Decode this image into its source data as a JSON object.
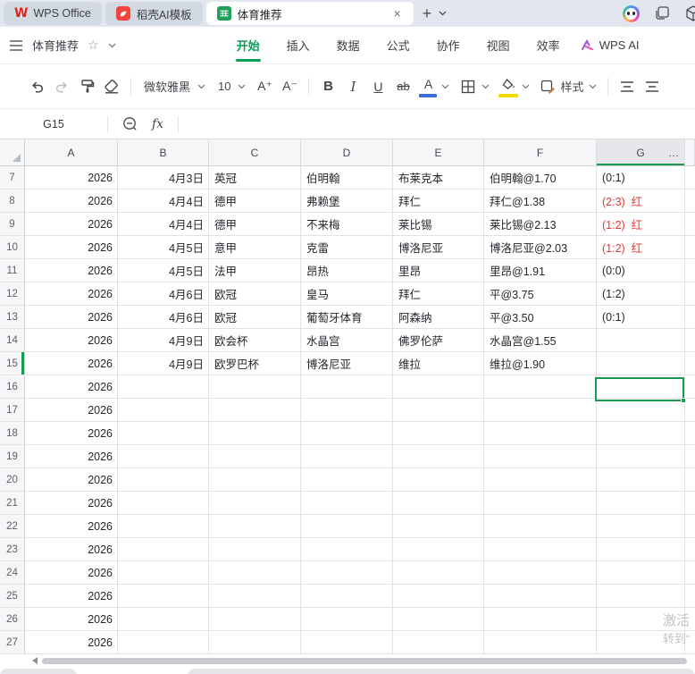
{
  "window": {
    "tabs": [
      {
        "label": "WPS Office"
      },
      {
        "label": "稻壳AI模板"
      },
      {
        "label": "体育推荐",
        "close_glyph": "×"
      }
    ],
    "new_tab_glyph": "+"
  },
  "menubar": {
    "doc_title": "体育推荐",
    "items": [
      "开始",
      "插入",
      "数据",
      "公式",
      "协作",
      "视图",
      "效率"
    ],
    "active_item": "开始",
    "wps_ai_label": "WPS AI"
  },
  "toolbar": {
    "font_name": "微软雅黑",
    "font_size": "10",
    "bold_label": "B",
    "italic_label": "I",
    "underline_label": "U",
    "strike_label": "ab",
    "font_color_label": "A",
    "increase_font_label": "A⁺",
    "decrease_font_label": "A⁻",
    "styles_label": "样式"
  },
  "formula_bar": {
    "cell_ref": "G15",
    "fx_label": "fx",
    "value": ""
  },
  "grid": {
    "columns": [
      "A",
      "B",
      "C",
      "D",
      "E",
      "F",
      "G"
    ],
    "selected_column": "G",
    "selected_cell": "G15",
    "selected_row": 15,
    "more_label": "…",
    "rows": [
      {
        "n": 7,
        "a": "2026",
        "b": "4月3日",
        "c": "英冠",
        "d": "伯明翰",
        "e": "布莱克本",
        "f": "伯明翰@1.70",
        "g": "(0:1)",
        "g_red": false
      },
      {
        "n": 8,
        "a": "2026",
        "b": "4月4日",
        "c": "德甲",
        "d": "弗赖堡",
        "e": "拜仁",
        "f": "拜仁@1.38",
        "g": "(2:3)  红",
        "g_red": true
      },
      {
        "n": 9,
        "a": "2026",
        "b": "4月4日",
        "c": "德甲",
        "d": "不来梅",
        "e": "莱比锡",
        "f": "莱比锡@2.13",
        "g": "(1:2)  红",
        "g_red": true
      },
      {
        "n": 10,
        "a": "2026",
        "b": "4月5日",
        "c": "意甲",
        "d": "克雷",
        "e": "博洛尼亚",
        "f": "博洛尼亚@2.03",
        "g": "(1:2)  红",
        "g_red": true
      },
      {
        "n": 11,
        "a": "2026",
        "b": "4月5日",
        "c": "法甲",
        "d": "昂热",
        "e": "里昂",
        "f": "里昂@1.91",
        "g": "(0:0)",
        "g_red": false
      },
      {
        "n": 12,
        "a": "2026",
        "b": "4月6日",
        "c": "欧冠",
        "d": "皇马",
        "e": "拜仁",
        "f": "平@3.75",
        "g": "(1:2)",
        "g_red": false
      },
      {
        "n": 13,
        "a": "2026",
        "b": "4月6日",
        "c": "欧冠",
        "d": "葡萄牙体育",
        "e": "阿森纳",
        "f": "平@3.50",
        "g": "(0:1)",
        "g_red": false
      },
      {
        "n": 14,
        "a": "2026",
        "b": "4月9日",
        "c": "欧会杯",
        "d": "水晶宫",
        "e": "佛罗伦萨",
        "f": "水晶宫@1.55",
        "g": "",
        "g_red": false
      },
      {
        "n": 15,
        "a": "2026",
        "b": "4月9日",
        "c": "欧罗巴杯",
        "d": "博洛尼亚",
        "e": "维拉",
        "f": "维拉@1.90",
        "g": "",
        "g_red": false
      },
      {
        "n": 16,
        "a": "2026"
      },
      {
        "n": 17,
        "a": "2026"
      },
      {
        "n": 18,
        "a": "2026"
      },
      {
        "n": 19,
        "a": "2026"
      },
      {
        "n": 20,
        "a": "2026"
      },
      {
        "n": 21,
        "a": "2026"
      },
      {
        "n": 22,
        "a": "2026"
      },
      {
        "n": 23,
        "a": "2026"
      },
      {
        "n": 24,
        "a": "2026"
      },
      {
        "n": 25,
        "a": "2026"
      },
      {
        "n": 26,
        "a": "2026"
      },
      {
        "n": 27,
        "a": "2026"
      }
    ]
  },
  "watermark": {
    "line1": "激活",
    "line2": "转到“"
  },
  "colors": {
    "accent_green": "#189a55",
    "alert_red": "#e8382f",
    "brand_red": "#e1251b",
    "sheet_icon_green": "#1fa05a",
    "font_color_blue": "#3d6be0",
    "fill_yellow": "#f2dc00",
    "tabbar_bg": "#e2e6ee"
  }
}
